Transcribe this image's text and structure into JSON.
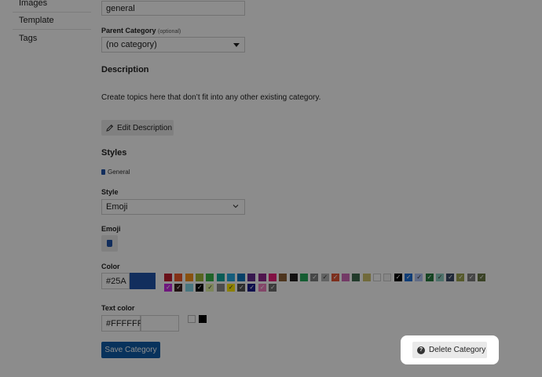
{
  "sidebar": {
    "items": [
      {
        "label": "Images"
      },
      {
        "label": "Template"
      },
      {
        "label": "Tags"
      }
    ]
  },
  "form": {
    "slug_value": "general",
    "parent_category": {
      "label": "Parent Category",
      "optional": "(optional)",
      "value": "(no category)"
    },
    "description": {
      "heading": "Description",
      "text": "Create topics here that don’t fit into any other existing category.",
      "edit_button": "Edit Description"
    },
    "styles": {
      "heading": "Styles",
      "badge_name": "General",
      "style_label": "Style",
      "style_value": "Emoji",
      "emoji_label": "Emoji",
      "color_label": "Color",
      "color_value": "#25A",
      "text_color_label": "Text color",
      "text_color_value": "#FFFFFF"
    },
    "save_button": "Save Category",
    "delete_button": "Delete Category"
  },
  "colors": {
    "accent": "#0f5ca8",
    "category_color": "#2255AA",
    "palette_row1": [
      "#BF1E2E",
      "#F1592A",
      "#F7941D",
      "#9EB83B",
      "#3AB54A",
      "#12A89D",
      "#25AAE2",
      "#0E76BD",
      "#652D90",
      "#92278F",
      "#ED207B",
      "#8C6238",
      "#231F20",
      "#27AA5B",
      "#808281",
      "#B3B5B4",
      "#E45735",
      "#D16ABA",
      "#3E6C4F",
      "#CEC26C",
      "#FFFFFF",
      "#F4F4F4",
      "#000000",
      "#1C6FD8",
      "#B1C5F5",
      "#277D3E",
      "#8FCEC2",
      "#3B4B66",
      "#9DA54F",
      "#808080",
      "#6A7845"
    ],
    "palette_row2": [
      "#CA2AE4",
      "#3C2221",
      "#86D8E7",
      "#000000",
      "#E4F5A7",
      "#8B8B8B",
      "#FFEA00",
      "#555555",
      "#1A1A8C",
      "#F080C0",
      "#6C6C6C"
    ],
    "checked_row1": [
      14,
      15,
      16,
      22,
      23,
      24,
      25,
      26,
      27,
      28,
      29,
      30
    ],
    "checked_row2": [
      0,
      1,
      3,
      4,
      6,
      7,
      8,
      9,
      10
    ],
    "text_swatches": [
      "#FFFFFF",
      "#000000"
    ]
  },
  "icons": {
    "select_arrow": "caret-down-icon",
    "chevron": "chevron-down-icon",
    "pencil": "pencil-icon",
    "question": "question-circle-icon",
    "emoji": "cup-icon"
  }
}
